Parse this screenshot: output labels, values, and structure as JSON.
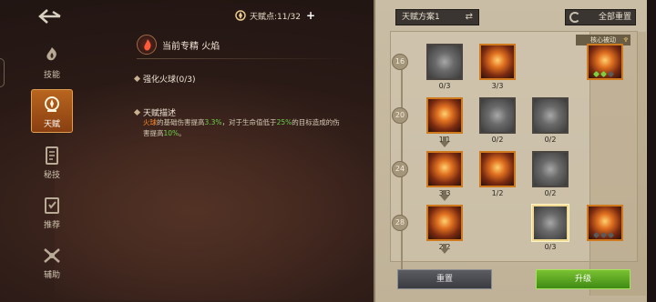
{
  "nav": {
    "items": [
      {
        "label": "技能",
        "icon": "skill-icon"
      },
      {
        "label": "天赋",
        "icon": "talent-icon"
      },
      {
        "label": "秘技",
        "icon": "secret-icon"
      },
      {
        "label": "推荐",
        "icon": "recommend-icon"
      },
      {
        "label": "辅助",
        "icon": "assist-icon"
      }
    ],
    "active_index": 1
  },
  "talent_points": {
    "label": "天赋点:11/32",
    "plus": "+"
  },
  "detail": {
    "specialty": "当前专精 火焰",
    "skill_name": "强化火球(0/3)",
    "desc_title": "天赋描述",
    "desc_parts": {
      "p1": "火球",
      "p2": "的基础伤害提高",
      "p3": "3.3%",
      "p4": "，对于生命值低于",
      "p5": "25%",
      "p6": "的目标造成的伤害提高",
      "p7": "10%",
      "p8": "。"
    }
  },
  "panel": {
    "scheme_label": "天赋方案1",
    "reset_all_label": "全部重置",
    "core_passive_label": "核心被动",
    "tiers": [
      "16",
      "20",
      "24",
      "28"
    ],
    "nodes": {
      "r1c1": "0/3",
      "r1c2": "3/3",
      "r2c1": "1/1",
      "r2c2": "0/2",
      "r2c3": "0/2",
      "r3c1": "3/3",
      "r3c2": "1/2",
      "r3c3": "0/2",
      "r4c1": "2/2",
      "r4c3": "0/3"
    },
    "reset_label": "重置",
    "upgrade_label": "升级"
  },
  "colors": {
    "accent_orange": "#ff8a2a",
    "accent_green": "#6ad24a",
    "upgrade_green": "#5aa822",
    "active_tab": "#b8651e"
  }
}
